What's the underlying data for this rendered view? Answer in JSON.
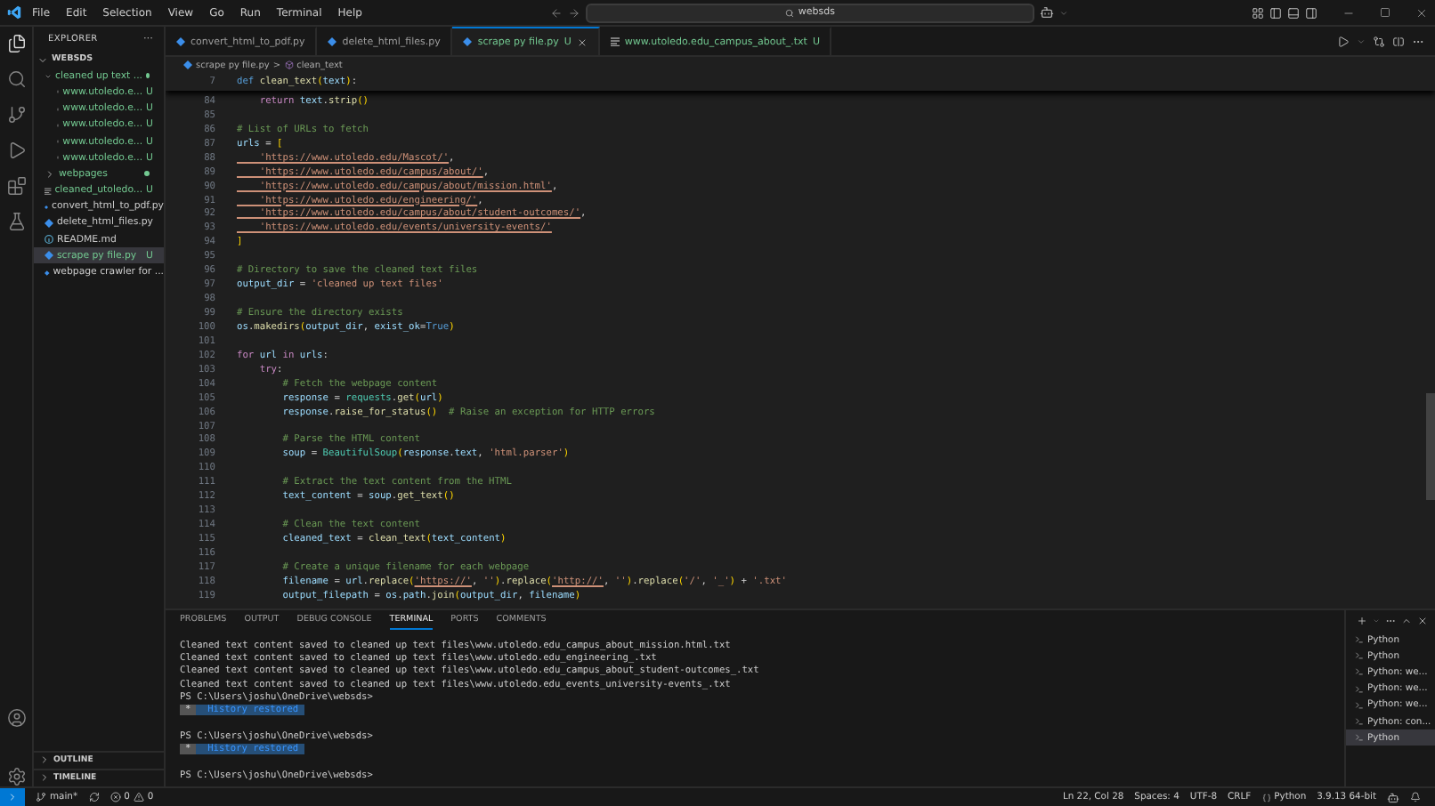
{
  "menu": [
    "File",
    "Edit",
    "Selection",
    "View",
    "Go",
    "Run",
    "Terminal",
    "Help"
  ],
  "command_center": {
    "value": "websds"
  },
  "explorer": {
    "title": "EXPLORER",
    "more": "···",
    "root": "WEBSDS",
    "tree": [
      {
        "label": "cleaned up text ...",
        "kind": "folder",
        "expanded": true,
        "modified": true,
        "selected": false,
        "children": [
          {
            "label": "www.utoledo.e...",
            "kind": "txt",
            "status": "U",
            "selected": false
          },
          {
            "label": "www.utoledo.e...",
            "kind": "txt",
            "status": "U",
            "selected": false
          },
          {
            "label": "www.utoledo.e...",
            "kind": "txt",
            "status": "U",
            "selected": false
          },
          {
            "label": "www.utoledo.e...",
            "kind": "txt",
            "status": "U",
            "selected": false
          },
          {
            "label": "www.utoledo.e...",
            "kind": "txt",
            "status": "U",
            "selected": false
          }
        ]
      },
      {
        "label": "webpages",
        "kind": "folder",
        "expanded": false,
        "modified": true,
        "selected": false
      },
      {
        "label": "cleaned_utoledo...",
        "kind": "txt",
        "status": "U",
        "selected": false
      },
      {
        "label": "convert_html_to_pdf.py",
        "kind": "py",
        "selected": false
      },
      {
        "label": "delete_html_files.py",
        "kind": "py",
        "selected": false
      },
      {
        "label": "README.md",
        "kind": "md",
        "selected": false
      },
      {
        "label": "scrape py file.py",
        "kind": "py",
        "status": "U",
        "selected": true
      },
      {
        "label": "webpage crawler for ...",
        "kind": "py",
        "selected": false
      }
    ],
    "sections": [
      "OUTLINE",
      "TIMELINE"
    ]
  },
  "tabs": [
    {
      "label": "convert_html_to_pdf.py",
      "kind": "py",
      "selected": false
    },
    {
      "label": "delete_html_files.py",
      "kind": "py",
      "selected": false
    },
    {
      "label": "scrape py file.py",
      "kind": "py",
      "status": "U",
      "selected": true
    },
    {
      "label": "www.utoledo.edu_campus_about_.txt",
      "kind": "txt",
      "status": "U",
      "selected": false
    }
  ],
  "breadcrumb": {
    "file": "scrape py file.py",
    "separator": ">",
    "symbol": "clean_text"
  },
  "sticky_line": {
    "number": "7",
    "tokens": [
      {
        "kind": "kw",
        "text": "def "
      },
      {
        "kind": "fn",
        "text": "clean_text"
      },
      {
        "kind": "br",
        "text": "("
      },
      {
        "kind": "var",
        "text": "text"
      },
      {
        "kind": "br",
        "text": ")"
      },
      {
        "kind": "plain",
        "text": ":"
      }
    ]
  },
  "code": [
    {
      "number": "84",
      "tokens": [
        {
          "kind": "ctl",
          "text": "    return "
        },
        {
          "kind": "var",
          "text": "text"
        },
        {
          "kind": "plain",
          "text": "."
        },
        {
          "kind": "fn",
          "text": "strip"
        },
        {
          "kind": "br",
          "text": "()"
        }
      ]
    },
    {
      "number": "85"
    },
    {
      "number": "86",
      "tokens": [
        {
          "kind": "cmt",
          "text": "# List of URLs to fetch"
        }
      ]
    },
    {
      "number": "87",
      "tokens": [
        {
          "kind": "var",
          "text": "urls"
        },
        {
          "kind": "plain",
          "text": " = "
        },
        {
          "kind": "br",
          "text": "["
        }
      ]
    },
    {
      "number": "88",
      "tokens": [
        {
          "kind": "str",
          "text": "    'https://www.utoledo.edu/Mascot/'"
        },
        {
          "kind": "plain",
          "text": ","
        }
      ]
    },
    {
      "number": "89",
      "tokens": [
        {
          "kind": "str",
          "text": "    'https://www.utoledo.edu/campus/about/'"
        },
        {
          "kind": "plain",
          "text": ","
        }
      ]
    },
    {
      "number": "90",
      "tokens": [
        {
          "kind": "str",
          "text": "    'https://www.utoledo.edu/campus/about/mission.html'"
        },
        {
          "kind": "plain",
          "text": ","
        }
      ]
    },
    {
      "number": "91",
      "tokens": [
        {
          "kind": "str",
          "text": "    'https://www.utoledo.edu/engineering/'"
        },
        {
          "kind": "plain",
          "text": ","
        }
      ]
    },
    {
      "number": "92",
      "tokens": [
        {
          "kind": "str",
          "text": "    'https://www.utoledo.edu/campus/about/student-outcomes/'"
        },
        {
          "kind": "plain",
          "text": ","
        }
      ]
    },
    {
      "number": "93",
      "tokens": [
        {
          "kind": "str",
          "text": "    'https://www.utoledo.edu/events/university-events/'"
        }
      ]
    },
    {
      "number": "94",
      "tokens": [
        {
          "kind": "br",
          "text": "]"
        }
      ]
    },
    {
      "number": "95"
    },
    {
      "number": "96",
      "tokens": [
        {
          "kind": "cmt",
          "text": "# Directory to save the cleaned text files"
        }
      ]
    },
    {
      "number": "97",
      "tokens": [
        {
          "kind": "var",
          "text": "output_dir"
        },
        {
          "kind": "plain",
          "text": " = "
        },
        {
          "kind": "str",
          "text": "'cleaned up text files'"
        }
      ]
    },
    {
      "number": "98"
    },
    {
      "number": "99",
      "tokens": [
        {
          "kind": "cmt",
          "text": "# Ensure the directory exists"
        }
      ]
    },
    {
      "number": "100",
      "tokens": [
        {
          "kind": "var",
          "text": "os"
        },
        {
          "kind": "plain",
          "text": "."
        },
        {
          "kind": "fn",
          "text": "makedirs"
        },
        {
          "kind": "br",
          "text": "("
        },
        {
          "kind": "var",
          "text": "output_dir"
        },
        {
          "kind": "plain",
          "text": ", "
        },
        {
          "kind": "var",
          "text": "exist_ok"
        },
        {
          "kind": "plain",
          "text": "="
        },
        {
          "kind": "kw",
          "text": "True"
        },
        {
          "kind": "br",
          "text": ")"
        }
      ]
    },
    {
      "number": "101"
    },
    {
      "number": "102",
      "tokens": [
        {
          "kind": "ctl",
          "text": "for "
        },
        {
          "kind": "var",
          "text": "url"
        },
        {
          "kind": "ctl",
          "text": " in "
        },
        {
          "kind": "var",
          "text": "urls"
        },
        {
          "kind": "plain",
          "text": ":"
        }
      ]
    },
    {
      "number": "103",
      "tokens": [
        {
          "kind": "ctl",
          "text": "    try"
        },
        {
          "kind": "plain",
          "text": ":"
        }
      ]
    },
    {
      "number": "104",
      "tokens": [
        {
          "kind": "cmt",
          "text": "        # Fetch the webpage content"
        }
      ]
    },
    {
      "number": "105",
      "tokens": [
        {
          "kind": "var",
          "text": "        response"
        },
        {
          "kind": "plain",
          "text": " = "
        },
        {
          "kind": "cls",
          "text": "requests"
        },
        {
          "kind": "plain",
          "text": "."
        },
        {
          "kind": "fn",
          "text": "get"
        },
        {
          "kind": "br",
          "text": "("
        },
        {
          "kind": "var",
          "text": "url"
        },
        {
          "kind": "br",
          "text": ")"
        }
      ]
    },
    {
      "number": "106",
      "tokens": [
        {
          "kind": "var",
          "text": "        response"
        },
        {
          "kind": "plain",
          "text": "."
        },
        {
          "kind": "fn",
          "text": "raise_for_status"
        },
        {
          "kind": "br",
          "text": "()"
        },
        {
          "kind": "cmt",
          "text": "  # Raise an exception for HTTP errors"
        }
      ]
    },
    {
      "number": "107"
    },
    {
      "number": "108",
      "tokens": [
        {
          "kind": "cmt",
          "text": "        # Parse the HTML content"
        }
      ]
    },
    {
      "number": "109",
      "tokens": [
        {
          "kind": "var",
          "text": "        soup"
        },
        {
          "kind": "plain",
          "text": " = "
        },
        {
          "kind": "cls",
          "text": "BeautifulSoup"
        },
        {
          "kind": "br",
          "text": "("
        },
        {
          "kind": "var",
          "text": "response"
        },
        {
          "kind": "plain",
          "text": "."
        },
        {
          "kind": "var",
          "text": "text"
        },
        {
          "kind": "plain",
          "text": ", "
        },
        {
          "kind": "str",
          "text": "'html.parser'"
        },
        {
          "kind": "br",
          "text": ")"
        }
      ]
    },
    {
      "number": "110"
    },
    {
      "number": "111",
      "tokens": [
        {
          "kind": "cmt",
          "text": "        # Extract the text content from the HTML"
        }
      ]
    },
    {
      "number": "112",
      "tokens": [
        {
          "kind": "var",
          "text": "        text_content"
        },
        {
          "kind": "plain",
          "text": " = "
        },
        {
          "kind": "var",
          "text": "soup"
        },
        {
          "kind": "plain",
          "text": "."
        },
        {
          "kind": "fn",
          "text": "get_text"
        },
        {
          "kind": "br",
          "text": "()"
        }
      ]
    },
    {
      "number": "113"
    },
    {
      "number": "114",
      "tokens": [
        {
          "kind": "cmt",
          "text": "        # Clean the text content"
        }
      ]
    },
    {
      "number": "115",
      "tokens": [
        {
          "kind": "var",
          "text": "        cleaned_text"
        },
        {
          "kind": "plain",
          "text": " = "
        },
        {
          "kind": "fn",
          "text": "clean_text"
        },
        {
          "kind": "br",
          "text": "("
        },
        {
          "kind": "var",
          "text": "text_content"
        },
        {
          "kind": "br",
          "text": ")"
        }
      ]
    },
    {
      "number": "116"
    },
    {
      "number": "117",
      "tokens": [
        {
          "kind": "cmt",
          "text": "        # Create a unique filename for each webpage"
        }
      ]
    },
    {
      "number": "118",
      "tokens": [
        {
          "kind": "var",
          "text": "        filename"
        },
        {
          "kind": "plain",
          "text": " = "
        },
        {
          "kind": "var",
          "text": "url"
        },
        {
          "kind": "plain",
          "text": "."
        },
        {
          "kind": "fn",
          "text": "replace"
        },
        {
          "kind": "br",
          "text": "("
        },
        {
          "kind": "str",
          "text": "'https://'"
        },
        {
          "kind": "plain",
          "text": ", "
        },
        {
          "kind": "str",
          "text": "''"
        },
        {
          "kind": "br",
          "text": ")"
        },
        {
          "kind": "plain",
          "text": "."
        },
        {
          "kind": "fn",
          "text": "replace"
        },
        {
          "kind": "br",
          "text": "("
        },
        {
          "kind": "str",
          "text": "'http://'"
        },
        {
          "kind": "plain",
          "text": ", "
        },
        {
          "kind": "str",
          "text": "''"
        },
        {
          "kind": "br",
          "text": ")"
        },
        {
          "kind": "plain",
          "text": "."
        },
        {
          "kind": "fn",
          "text": "replace"
        },
        {
          "kind": "br",
          "text": "("
        },
        {
          "kind": "str",
          "text": "'/'"
        },
        {
          "kind": "plain",
          "text": ", "
        },
        {
          "kind": "str",
          "text": "'_'"
        },
        {
          "kind": "br",
          "text": ")"
        },
        {
          "kind": "plain",
          "text": " + "
        },
        {
          "kind": "str",
          "text": "'.txt'"
        }
      ]
    },
    {
      "number": "119",
      "tokens": [
        {
          "kind": "var",
          "text": "        output_filepath"
        },
        {
          "kind": "plain",
          "text": " = "
        },
        {
          "kind": "var",
          "text": "os"
        },
        {
          "kind": "plain",
          "text": "."
        },
        {
          "kind": "var",
          "text": "path"
        },
        {
          "kind": "plain",
          "text": "."
        },
        {
          "kind": "fn",
          "text": "join"
        },
        {
          "kind": "br",
          "text": "("
        },
        {
          "kind": "var",
          "text": "output_dir"
        },
        {
          "kind": "plain",
          "text": ", "
        },
        {
          "kind": "var",
          "text": "filename"
        },
        {
          "kind": "br",
          "text": ")"
        }
      ]
    }
  ],
  "panel": {
    "tabs": [
      {
        "label": "PROBLEMS",
        "selected": false
      },
      {
        "label": "OUTPUT",
        "selected": false
      },
      {
        "label": "DEBUG CONSOLE",
        "selected": false
      },
      {
        "label": "TERMINAL",
        "selected": true
      },
      {
        "label": "PORTS",
        "selected": false
      },
      {
        "label": "COMMENTS",
        "selected": false
      }
    ],
    "terminal": [
      {
        "kind": "text",
        "text": "Cleaned text content saved to cleaned up text files\\www.utoledo.edu_campus_about_mission.html.txt"
      },
      {
        "kind": "text",
        "text": "Cleaned text content saved to cleaned up text files\\www.utoledo.edu_engineering_.txt"
      },
      {
        "kind": "text",
        "text": "Cleaned text content saved to cleaned up text files\\www.utoledo.edu_campus_about_student-outcomes_.txt"
      },
      {
        "kind": "text",
        "text": "Cleaned text content saved to cleaned up text files\\www.utoledo.edu_events_university-events_.txt"
      },
      {
        "kind": "text",
        "text": "PS C:\\Users\\joshu\\OneDrive\\websds>"
      },
      {
        "kind": "notice",
        "mark": "*",
        "text": "History restored"
      },
      {
        "kind": "blank"
      },
      {
        "kind": "text",
        "text": "PS C:\\Users\\joshu\\OneDrive\\websds>"
      },
      {
        "kind": "notice",
        "mark": "*",
        "text": "History restored"
      },
      {
        "kind": "blank"
      },
      {
        "kind": "text",
        "text": "PS C:\\Users\\joshu\\OneDrive\\websds>"
      }
    ],
    "terminal_list": [
      {
        "label": "Python",
        "selected": false
      },
      {
        "label": "Python",
        "selected": false
      },
      {
        "label": "Python: we...",
        "selected": false
      },
      {
        "label": "Python: we...",
        "selected": false
      },
      {
        "label": "Python: we...",
        "selected": false
      },
      {
        "label": "Python: con...",
        "selected": false
      },
      {
        "label": "Python",
        "selected": true
      }
    ]
  },
  "status_bar": {
    "branch": "main*",
    "errors": "0",
    "warnings": "0",
    "right": [
      {
        "kind": "text",
        "text": "Ln 22, Col 28"
      },
      {
        "kind": "text",
        "text": "Spaces: 4"
      },
      {
        "kind": "text",
        "text": "UTF-8"
      },
      {
        "kind": "text",
        "text": "CRLF"
      },
      {
        "kind": "language",
        "text": "Python"
      },
      {
        "kind": "text",
        "text": "3.9.13 64-bit"
      }
    ]
  }
}
